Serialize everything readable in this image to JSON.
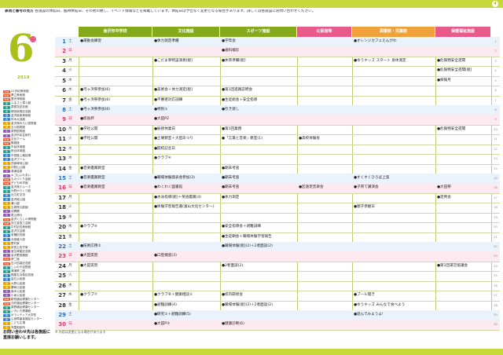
{
  "page_number": "4",
  "legend_title": "表現と番号の見方",
  "legend_text": "各施設の休館日、臨時休館日、その他の催し、イベント情報などを掲載しています。休館日は予告なく変更となる場合があります。詳しくは各施設にお問い合わせください。",
  "month": "6",
  "year_label": "2019",
  "columns": [
    "金沢市中学校",
    "文化施設",
    "スポーツ施設",
    "公民館等",
    "図書館・児童館",
    "保健福祉施設"
  ],
  "facilities": [
    {
      "tag": "中央",
      "name": "21世紀美術館"
    },
    {
      "tag": "中央",
      "name": "県立美術館"
    },
    {
      "tag": "中央",
      "name": "歴史博物館"
    },
    {
      "tag": "東",
      "name": "ふるさと偉人館"
    },
    {
      "tag": "東",
      "name": "泉鏡花記念館"
    },
    {
      "tag": "東",
      "name": "徳田秋聲記念館"
    },
    {
      "tag": "西",
      "name": "金沢能楽美術館"
    },
    {
      "tag": "西",
      "name": "鈴木大拙館"
    },
    {
      "tag": "南",
      "name": "金沢海みらい図書館"
    },
    {
      "tag": "南",
      "name": "玉川図書館"
    },
    {
      "tag": "北",
      "name": "泉野図書館"
    },
    {
      "tag": "北",
      "name": "金沢市民芸術村"
    },
    {
      "tag": "中央",
      "name": "文化ホール"
    },
    {
      "tag": "中央",
      "name": "歌劇座"
    },
    {
      "tag": "東",
      "name": "市民体育館"
    },
    {
      "tag": "東",
      "name": "総合体育館"
    },
    {
      "tag": "西",
      "name": "市営陸上競技場"
    },
    {
      "tag": "西",
      "name": "金沢プール"
    },
    {
      "tag": "南",
      "name": "西部緑地公園"
    },
    {
      "tag": "南",
      "name": "卯辰山公園"
    },
    {
      "tag": "北",
      "name": "湯涌温泉"
    },
    {
      "tag": "北",
      "name": "キゴ山ふれあい"
    },
    {
      "tag": "中央",
      "name": "ものづくり会館"
    },
    {
      "tag": "中央",
      "name": "子ども科学館"
    },
    {
      "tag": "東",
      "name": "金沢港クルーズ"
    },
    {
      "tag": "東",
      "name": "大野からくり館"
    },
    {
      "tag": "西",
      "name": "近江町交流"
    },
    {
      "tag": "西",
      "name": "金沢城公園"
    },
    {
      "tag": "南",
      "name": "兼六園"
    },
    {
      "tag": "南",
      "name": "玉泉院丸庭園"
    },
    {
      "tag": "北",
      "name": "成巽閣"
    },
    {
      "tag": "北",
      "name": "尾山神社"
    },
    {
      "tag": "中央",
      "name": "金沢くらしの博物館"
    },
    {
      "tag": "中央",
      "name": "安江金箔工芸館"
    },
    {
      "tag": "東",
      "name": "中村記念美術館"
    },
    {
      "tag": "東",
      "name": "金沢文芸館"
    },
    {
      "tag": "西",
      "name": "老舗記念館"
    },
    {
      "tag": "西",
      "name": "寺島蔵人邸"
    },
    {
      "tag": "南",
      "name": "野村家"
    },
    {
      "tag": "南",
      "name": "前田土佐守家"
    },
    {
      "tag": "北",
      "name": "室生犀星記念館"
    },
    {
      "tag": "北",
      "name": "金沢蓄音器館"
    },
    {
      "tag": "中央",
      "name": "夢二館"
    },
    {
      "tag": "中央",
      "name": "石川四高記念館"
    },
    {
      "tag": "東",
      "name": "しいのき迎賓館"
    },
    {
      "tag": "東",
      "name": "湯涌夢二館"
    },
    {
      "tag": "西",
      "name": "銭屋五兵衛記念館"
    },
    {
      "tag": "西",
      "name": "金石公民館"
    },
    {
      "tag": "南",
      "name": "大野公民館"
    },
    {
      "tag": "南",
      "name": "粟崎公民館"
    },
    {
      "tag": "北",
      "name": "森本公民館"
    },
    {
      "tag": "北",
      "name": "小坂公民館"
    },
    {
      "tag": "中央",
      "name": "駅西福祉健康センター"
    },
    {
      "tag": "中央",
      "name": "元町福祉健康センター"
    },
    {
      "tag": "東",
      "name": "泉野福祉健康センター"
    },
    {
      "tag": "東",
      "name": "いきいき健康館"
    },
    {
      "tag": "西",
      "name": "ボランティア大学校"
    },
    {
      "tag": "西",
      "name": "心身障害者福祉センター"
    },
    {
      "tag": "南",
      "name": "こども広場"
    },
    {
      "tag": "南",
      "name": "児童相談所"
    }
  ],
  "tag_colors": {
    "中央": "#e4572e",
    "東": "#2a9d8f",
    "西": "#3a86c8",
    "南": "#e9a100",
    "北": "#8e5bb5"
  },
  "header_colors": [
    "#84a91a",
    "#84a91a",
    "#84a91a",
    "#e85a8a",
    "#f0a23a",
    "#e85a8a"
  ],
  "closing_note": "お問い合わせ先は各施設に直接お願いします。",
  "footer_text": "※ 内容は変更になる場合があります",
  "days": [
    {
      "d": "1",
      "w": "土",
      "t": "sat",
      "c": [
        "●運動会練習",
        "●休力測定準備",
        "●学年会",
        "",
        "●オレンジカフェえんがわ",
        ""
      ]
    },
    {
      "d": "2",
      "w": "日",
      "t": "sun",
      "c": [
        "",
        "",
        "●歯科検診",
        "",
        "",
        ""
      ]
    },
    {
      "d": "3",
      "w": "月",
      "t": "",
      "c": [
        "",
        "●こだま祭特設演奏[組]",
        "●体育準備[組]",
        "",
        "●ゆうキッズ スタート 身体測定",
        "●危険物安全週間"
      ]
    },
    {
      "d": "4",
      "w": "火",
      "t": "",
      "c": [
        "",
        "",
        "",
        "",
        "",
        "●危険物安全週間[組]"
      ]
    },
    {
      "d": "5",
      "w": "水",
      "t": "",
      "c": [
        "",
        "",
        "",
        "",
        "",
        "●保険月"
      ]
    },
    {
      "d": "6",
      "w": "木",
      "t": "",
      "c": [
        "●弓ヶ浜祭参加(6)",
        "●美術会＋体力測定[組]",
        "●第1回進路説明会",
        "",
        "",
        ""
      ]
    },
    {
      "d": "7",
      "w": "金",
      "t": "",
      "c": [
        "●弓ヶ浜祭参加(6)",
        "●不審者対応訓練",
        "●生徒総会＋安全指導",
        "",
        "",
        ""
      ]
    },
    {
      "d": "8",
      "w": "土",
      "t": "sat",
      "c": [
        "●弓ヶ浜祭参加(6)",
        "●特別①",
        "●引き渡し",
        "",
        "",
        ""
      ]
    },
    {
      "d": "9",
      "w": "日",
      "t": "sun",
      "c": [
        "●校長杯",
        "●大田P2",
        "",
        "",
        "",
        ""
      ]
    },
    {
      "d": "10",
      "w": "月",
      "t": "",
      "c": [
        "●学社公開",
        "●振替休業日",
        "●第1回業務",
        "",
        "",
        "●危険物安全週間"
      ]
    },
    {
      "d": "11",
      "w": "火",
      "t": "",
      "c": [
        "●学社公開",
        "●土曜教室＋大田あつり",
        "●「言葉と音楽」教室(1)",
        "●高校体験会",
        "",
        ""
      ]
    },
    {
      "d": "12",
      "w": "水",
      "t": "",
      "c": [
        "",
        "●開校記念日",
        "",
        "",
        "",
        ""
      ]
    },
    {
      "d": "13",
      "w": "木",
      "t": "",
      "c": [
        "",
        "●クラブ④",
        "",
        "",
        "",
        ""
      ]
    },
    {
      "d": "14",
      "w": "金",
      "t": "",
      "c": [
        "●音楽鑑賞教室",
        "",
        "●期末考査",
        "",
        "",
        ""
      ]
    },
    {
      "d": "15",
      "w": "土",
      "t": "sat",
      "c": [
        "●音楽鑑賞教室",
        "●職場体験発表会参加(3)",
        "●期末考査",
        "",
        "●すくすくひろば上弦",
        ""
      ]
    },
    {
      "d": "16",
      "w": "日",
      "t": "sun",
      "c": [
        "●音楽鑑賞教室",
        "●わくわく図書館",
        "●期末考査",
        "●区遠足音楽会",
        "●子育て講演会",
        "●大田祭"
      ]
    },
    {
      "d": "17",
      "w": "月",
      "t": "",
      "c": [
        "",
        "●水泳指導[組]＋英語鑑賞(4)",
        "●体力測定",
        "",
        "",
        "●定例会"
      ]
    },
    {
      "d": "18",
      "w": "火",
      "t": "",
      "c": [
        "",
        "●体験学習報告書(富山文化センター)",
        "",
        "",
        "●親子参観日",
        ""
      ]
    },
    {
      "d": "19",
      "w": "水",
      "t": "",
      "c": [
        "",
        "",
        "",
        "",
        "",
        ""
      ]
    },
    {
      "d": "20",
      "w": "木",
      "t": "",
      "c": [
        "●クラブ⑥",
        "",
        "●安全指導会＋避難訓練",
        "",
        "",
        ""
      ]
    },
    {
      "d": "21",
      "w": "金",
      "t": "",
      "c": [
        "",
        "",
        "●生徒朝会＋職場体験学習報告",
        "",
        "",
        ""
      ]
    },
    {
      "d": "22",
      "w": "土",
      "t": "sat",
      "c": [
        "●技術応用②",
        "",
        "●職場体験[組](2)＋2者面談(2)",
        "",
        "",
        ""
      ]
    },
    {
      "d": "23",
      "w": "日",
      "t": "sun",
      "c": [
        "●大田実習",
        "●口腔検査(3)",
        "",
        "",
        "",
        ""
      ]
    },
    {
      "d": "24",
      "w": "月",
      "t": "",
      "c": [
        "●大田実習",
        "",
        "●2者面談(2)",
        "",
        "",
        "●第1回運営協議会"
      ]
    },
    {
      "d": "25",
      "w": "火",
      "t": "",
      "c": [
        "",
        "",
        "",
        "",
        "",
        ""
      ]
    },
    {
      "d": "26",
      "w": "水",
      "t": "",
      "c": [
        "",
        "",
        "",
        "",
        "",
        ""
      ]
    },
    {
      "d": "27",
      "w": "木",
      "t": "",
      "c": [
        "●クラブ⑦",
        "●クラブ⑧＋健康相談①",
        "●校内研修会",
        "",
        "●プール開き",
        ""
      ]
    },
    {
      "d": "28",
      "w": "金",
      "t": "",
      "c": [
        "",
        "●避難訓練(4)",
        "●職場体験[組](2)＋2者面談(2)",
        "",
        "●ゆうキッズ みんなで食べよう",
        ""
      ]
    },
    {
      "d": "29",
      "w": "土",
      "t": "sat",
      "c": [
        "",
        "●研究①＋避難訓練(5)",
        "",
        "",
        "●遊んでみようよ!",
        ""
      ]
    },
    {
      "d": "30",
      "w": "日",
      "t": "sun",
      "c": [
        "",
        "●大田P③",
        "●健康診断(6)",
        "",
        "",
        ""
      ]
    }
  ]
}
